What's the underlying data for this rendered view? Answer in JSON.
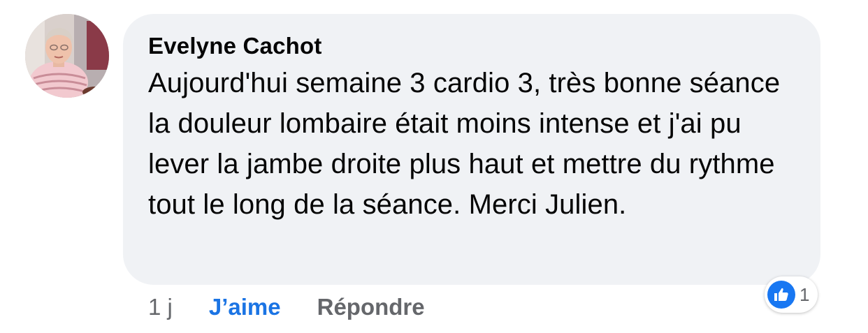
{
  "comment": {
    "author": "Evelyne Cachot",
    "text": "Aujourd'hui semaine 3 cardio 3, très bonne séance la douleur lombaire était moins intense et j'ai pu lever la jambe droite plus haut et mettre du rythme tout le long de la séance. Merci Julien."
  },
  "actions": {
    "time": "1 j",
    "like_label": "J’aime",
    "reply_label": "Répondre"
  },
  "reactions": {
    "icon": "thumbs-up-icon",
    "count": "1"
  },
  "colors": {
    "bubble_bg": "#f0f2f5",
    "like_blue": "#1b74e4",
    "muted_gray": "#65676b",
    "text": "#050505"
  }
}
